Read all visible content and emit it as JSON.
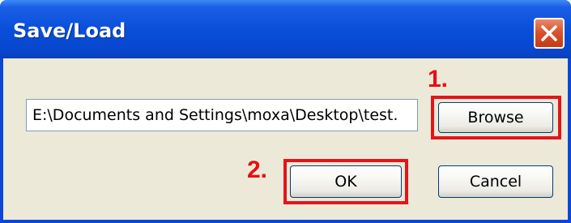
{
  "window": {
    "title": "Save/Load"
  },
  "form": {
    "path_value": "E:\\Documents and Settings\\moxa\\Desktop\\test.",
    "browse_label": "Browse",
    "ok_label": "OK",
    "cancel_label": "Cancel"
  },
  "annotations": {
    "step1": "1.",
    "step2": "2.",
    "highlight_color": "#e4141b"
  },
  "colors": {
    "titlebar": "#0a4fd8",
    "client_background": "#ece9d8",
    "close_button": "#d9542c"
  },
  "icons": {
    "close": "close-icon"
  }
}
